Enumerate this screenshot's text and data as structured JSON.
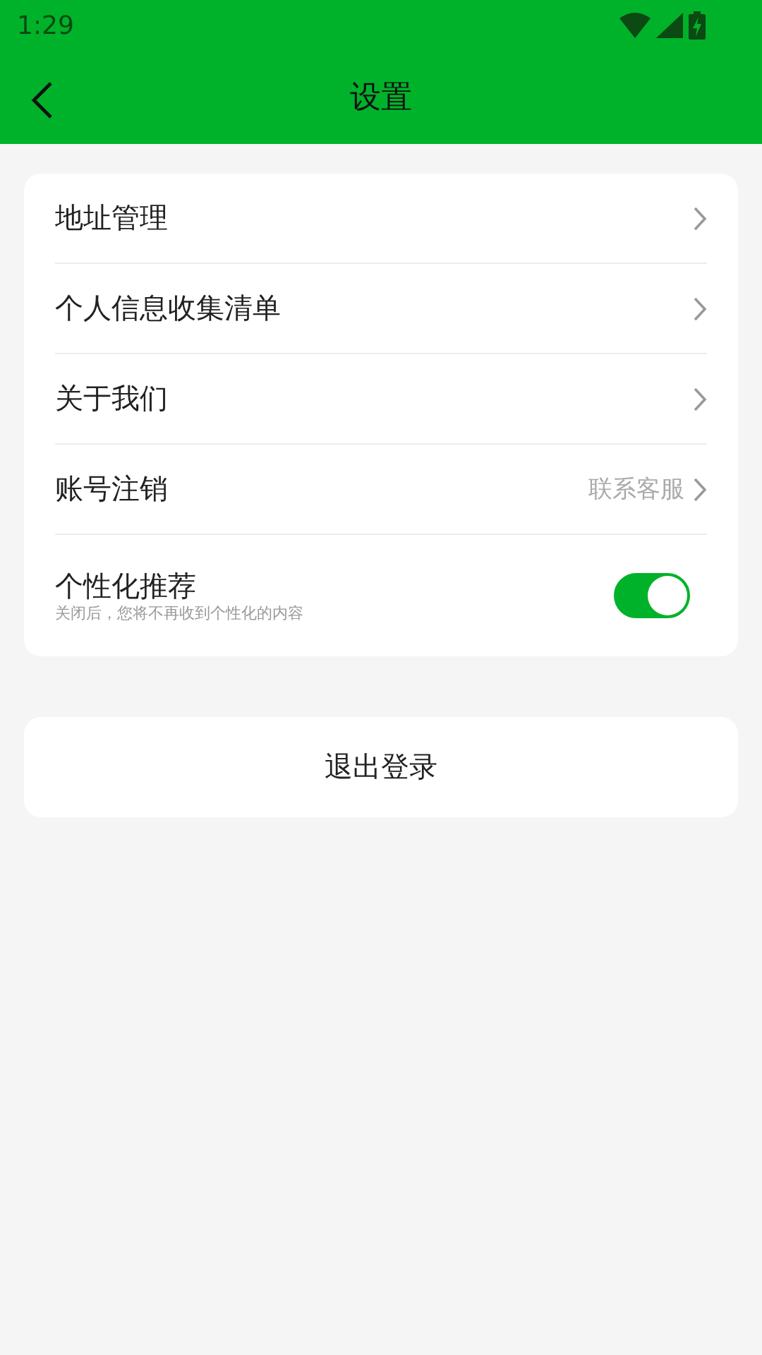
{
  "status_bar": {
    "time": "1:29"
  },
  "header": {
    "title": "设置"
  },
  "settings": [
    {
      "kind": "link",
      "label": "地址管理"
    },
    {
      "kind": "link",
      "label": "个人信息收集清单"
    },
    {
      "kind": "link",
      "label": "关于我们"
    },
    {
      "kind": "link",
      "label": "账号注销",
      "value": "联系客服"
    },
    {
      "kind": "toggle",
      "label": "个性化推荐",
      "description": "关闭后，您将不再收到个性化的内容",
      "on": true
    }
  ],
  "logout_button": "退出登录"
}
